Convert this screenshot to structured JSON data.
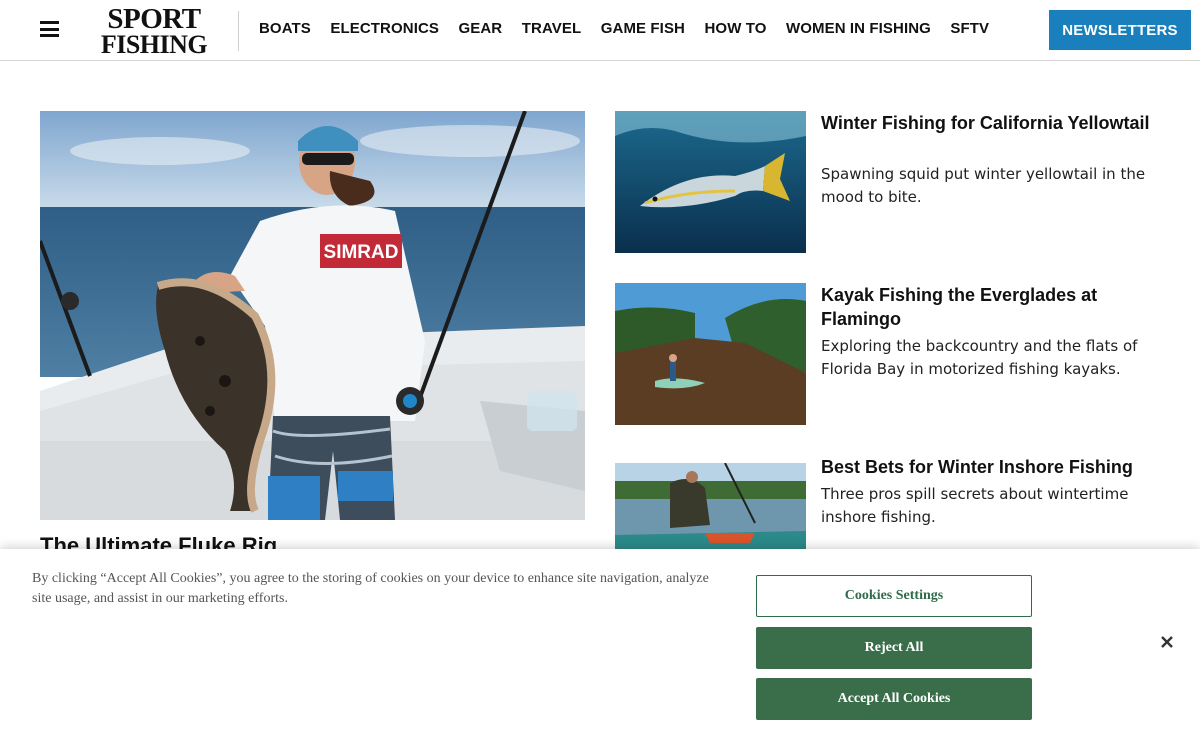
{
  "header": {
    "logo_line1": "SPORT",
    "logo_line2": "FISHING",
    "nav": [
      "BOATS",
      "ELECTRONICS",
      "GEAR",
      "TRAVEL",
      "GAME FISH",
      "HOW TO",
      "WOMEN IN FISHING",
      "SFTV"
    ],
    "newsletters_label": "NEWSLETTERS"
  },
  "hero": {
    "title": "The Ultimate Fluke Rig",
    "shirt_text": "SIMRAD"
  },
  "articles": [
    {
      "title": "Winter Fishing for California Yellowtail",
      "description": "Spawning squid put winter yellowtail in the mood to bite."
    },
    {
      "title": "Kayak Fishing the Everglades at Flamingo",
      "description": "Exploring the backcountry and the flats of Florida Bay in motorized fishing kayaks."
    },
    {
      "title": "Best Bets for Winter Inshore Fishing",
      "description": "Three pros spill secrets about wintertime inshore fishing."
    }
  ],
  "cookie": {
    "text": "By clicking “Accept All Cookies”, you agree to the storing of cookies on your device to enhance site navigation, analyze site usage, and assist in our marketing efforts.",
    "settings_label": "Cookies Settings",
    "reject_label": "Reject All",
    "accept_label": "Accept All Cookies"
  },
  "colors": {
    "newsletter_blue": "#1a7fbd",
    "cookie_green": "#3a6e4a"
  }
}
